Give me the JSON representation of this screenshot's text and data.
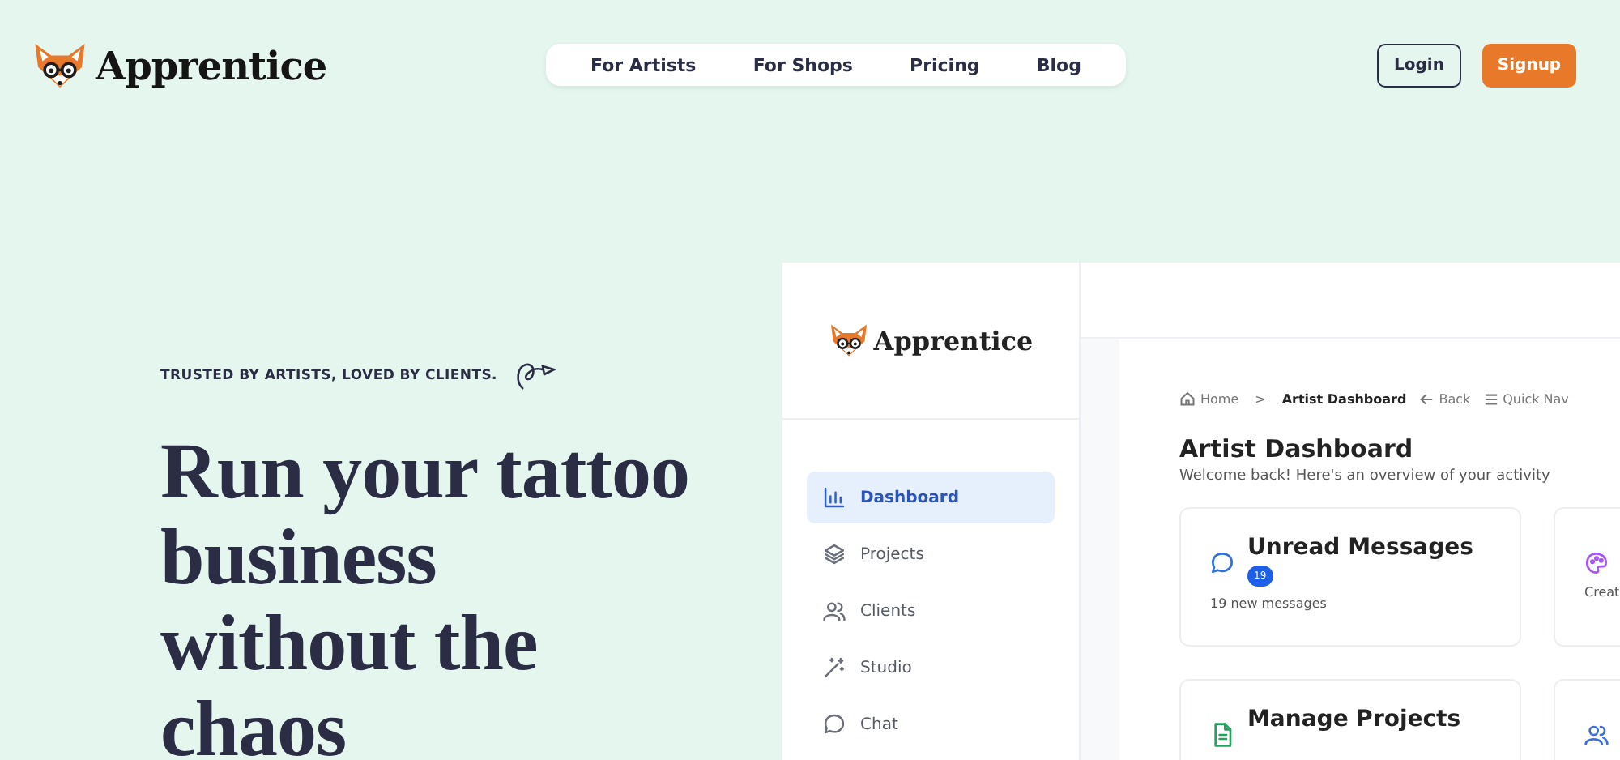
{
  "header": {
    "logo": "Apprentice",
    "nav": [
      {
        "label": "For Artists"
      },
      {
        "label": "For Shops"
      },
      {
        "label": "Pricing"
      },
      {
        "label": "Blog"
      }
    ],
    "login": "Login",
    "signup": "Signup"
  },
  "hero": {
    "tagline": "TRUSTED BY ARTISTS, LOVED BY CLIENTS.",
    "headline": "Run your tattoo\nbusiness\nwithout the\nchaos"
  },
  "dashboard": {
    "logo": "Apprentice",
    "sidebar": [
      {
        "label": "Dashboard",
        "kind": "chart",
        "selected": true
      },
      {
        "label": "Projects",
        "kind": "layers",
        "selected": false
      },
      {
        "label": "Clients",
        "kind": "people",
        "selected": false
      },
      {
        "label": "Studio",
        "kind": "wand",
        "selected": false
      },
      {
        "label": "Chat",
        "kind": "chat",
        "selected": false
      }
    ],
    "breadcrumb": {
      "home": "Home",
      "separator": ">",
      "current": "Artist Dashboard",
      "back": "Back",
      "quick_nav": "Quick Nav"
    },
    "title": "Artist Dashboard",
    "subtitle": "Welcome back! Here's an overview of your activity",
    "cards": [
      {
        "kind": "chat",
        "title": "Unread Messages",
        "badge": "19",
        "note": "19 new messages"
      },
      {
        "kind": "palette",
        "note": "Creat"
      },
      {
        "kind": "file",
        "title": "Manage Projects"
      },
      {
        "kind": "people"
      }
    ]
  }
}
